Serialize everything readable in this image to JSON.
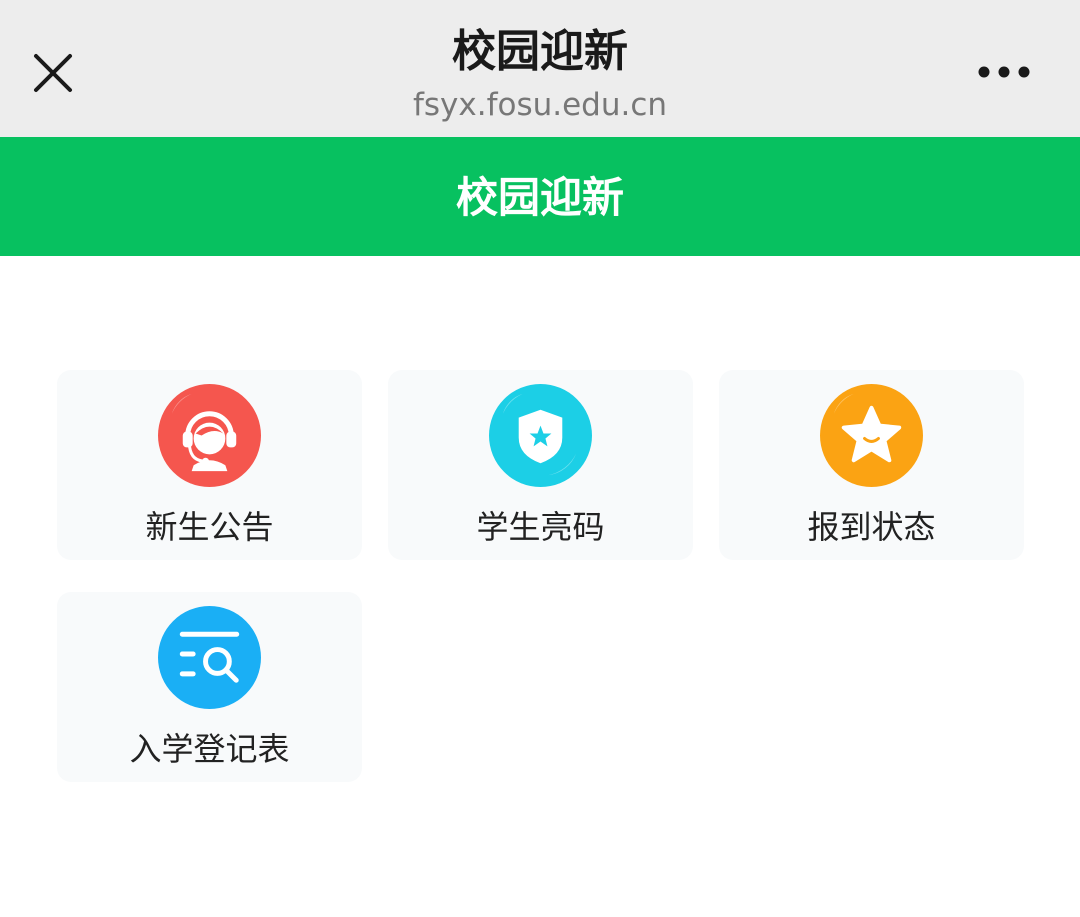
{
  "window": {
    "title": "校园迎新",
    "url": "fsyx.fosu.edu.cn"
  },
  "header": {
    "title": "校园迎新",
    "color": "#07c160"
  },
  "menu": [
    {
      "label": "新生公告",
      "icon": "customer-service-icon",
      "color": "#f5564e"
    },
    {
      "label": "学生亮码",
      "icon": "shield-star-icon",
      "color": "#1ccfe6"
    },
    {
      "label": "报到状态",
      "icon": "star-icon",
      "color": "#fba313"
    },
    {
      "label": "入学登记表",
      "icon": "list-search-icon",
      "color": "#1aaff5"
    }
  ]
}
